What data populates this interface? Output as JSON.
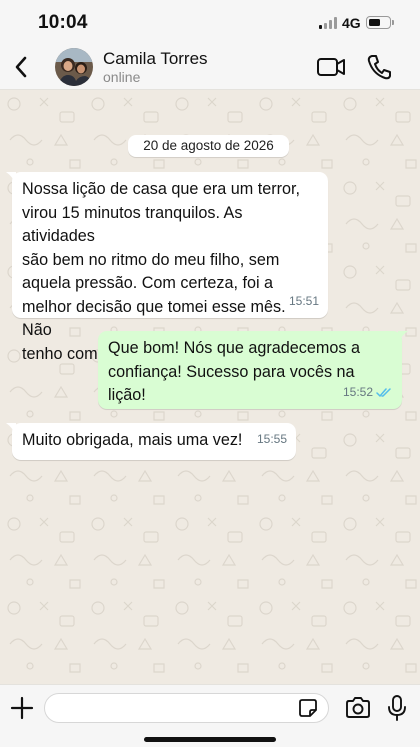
{
  "status_bar": {
    "time": "10:04",
    "network": "4G"
  },
  "header": {
    "back_icon": "chevron-left-icon",
    "contact_name": "Camila Torres",
    "contact_status": "online",
    "video_icon": "video-camera-icon",
    "call_icon": "phone-icon"
  },
  "chat": {
    "date_chip": "20 de agosto de 2026",
    "messages": [
      {
        "direction": "incoming",
        "lines": [
          "Nossa lição de casa que era um terror,",
          "virou 15 minutos tranquilos. As atividades",
          "são bem no ritmo do meu filho, sem",
          "aquela pressão. Com certeza, foi a",
          "melhor decisão que tomei esse mês. Não",
          "tenho como agradecer."
        ],
        "time": "15:51"
      },
      {
        "direction": "outgoing",
        "lines": [
          "Que bom! Nós que agradecemos a",
          "confiança! Sucesso para vocês na lição!"
        ],
        "time": "15:52",
        "receipt_icon": "double-check-read-icon"
      },
      {
        "direction": "incoming",
        "lines": [
          "Muito obrigada, mais uma vez!"
        ],
        "time": "15:55"
      }
    ]
  },
  "input_bar": {
    "plus_icon": "plus-icon",
    "input_value": "",
    "input_placeholder": "",
    "sticker_icon": "sticker-icon",
    "camera_icon": "camera-icon",
    "mic_icon": "microphone-icon"
  },
  "colors": {
    "chat_background": "#efeae2",
    "incoming_bubble": "#ffffff",
    "outgoing_bubble": "#d9fdd3",
    "read_receipt": "#53bdeb",
    "meta_text": "#667781"
  }
}
